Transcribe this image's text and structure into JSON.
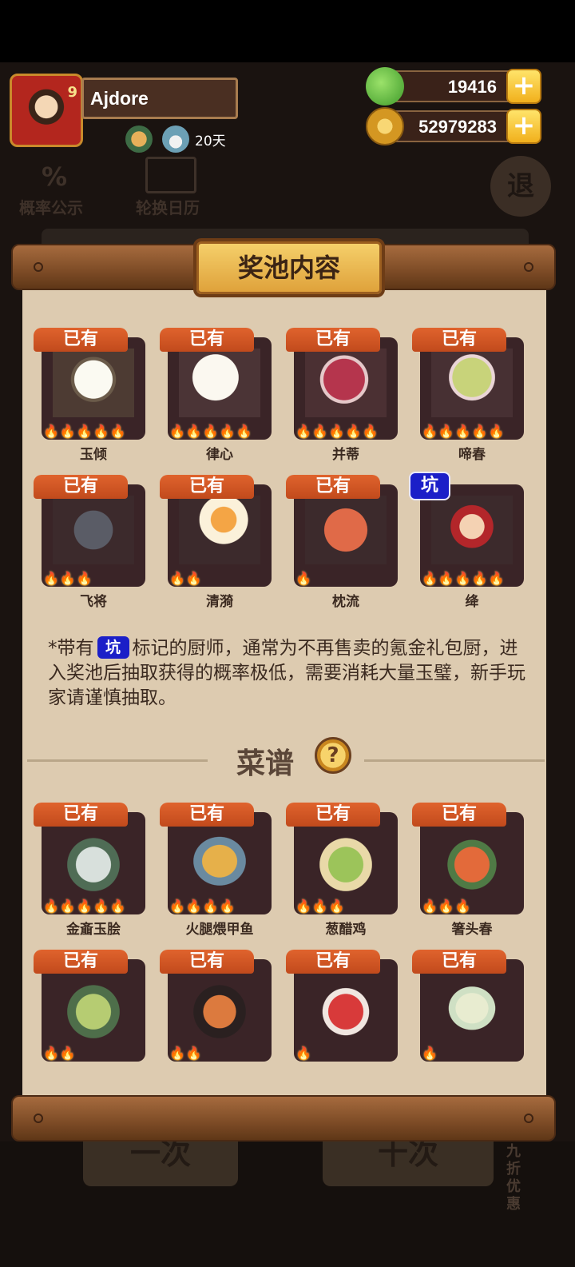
{
  "player": {
    "name": "Ajdore",
    "days": "20天",
    "avatar_badge": "9"
  },
  "currency": {
    "jade": "19416",
    "gold": "52979283",
    "plus": "+"
  },
  "background_buttons": {
    "probability": "概率公示",
    "probability_icon": "%",
    "calendar": "轮换日历",
    "exit": "退",
    "draw_one": "一次",
    "draw_ten": "十次",
    "discount": "九折优惠"
  },
  "panel": {
    "title": "奖池内容",
    "owned_tag": "已有",
    "keng_tag": "坑",
    "chefs": [
      {
        "name": "玉倾",
        "owned": true,
        "stars": "🔥🔥🔥🔥🔥"
      },
      {
        "name": "律心",
        "owned": true,
        "stars": "🔥🔥🔥🔥🔥"
      },
      {
        "name": "并蒂",
        "owned": true,
        "stars": "🔥🔥🔥🔥🔥"
      },
      {
        "name": "啼春",
        "owned": true,
        "stars": "🔥🔥🔥🔥🔥"
      },
      {
        "name": "飞将",
        "owned": true,
        "stars": "🔥🔥🔥"
      },
      {
        "name": "清漪",
        "owned": true,
        "stars": "🔥🔥"
      },
      {
        "name": "枕流",
        "owned": true,
        "stars": "🔥"
      },
      {
        "name": "绛",
        "owned": false,
        "stars": "🔥🔥🔥🔥🔥"
      }
    ],
    "note_prefix": "*带有",
    "note_text": "标记的厨师，通常为不再售卖的氪金礼包厨，进入奖池后抽取获得的概率极低，需要消耗大量玉璧，新手玩家请谨慎抽取。",
    "recipes_title": "菜谱",
    "help": "?",
    "recipes": [
      {
        "name": "金齑玉脍",
        "owned": true,
        "stars": "🔥🔥🔥🔥🔥"
      },
      {
        "name": "火腿煨甲鱼",
        "owned": true,
        "stars": "🔥🔥🔥🔥"
      },
      {
        "name": "葱醋鸡",
        "owned": true,
        "stars": "🔥🔥🔥"
      },
      {
        "name": "箸头春",
        "owned": true,
        "stars": "🔥🔥🔥"
      },
      {
        "name": "",
        "owned": true,
        "stars": "🔥🔥"
      },
      {
        "name": "",
        "owned": true,
        "stars": "🔥🔥"
      },
      {
        "name": "",
        "owned": true,
        "stars": "🔥"
      },
      {
        "name": "",
        "owned": true,
        "stars": "🔥"
      }
    ]
  },
  "colors": {
    "owned_tag": "#d4552a",
    "keng_tag": "#1b1fc8",
    "parchment": "#ddcbb0",
    "rod": "#7d4b26"
  }
}
